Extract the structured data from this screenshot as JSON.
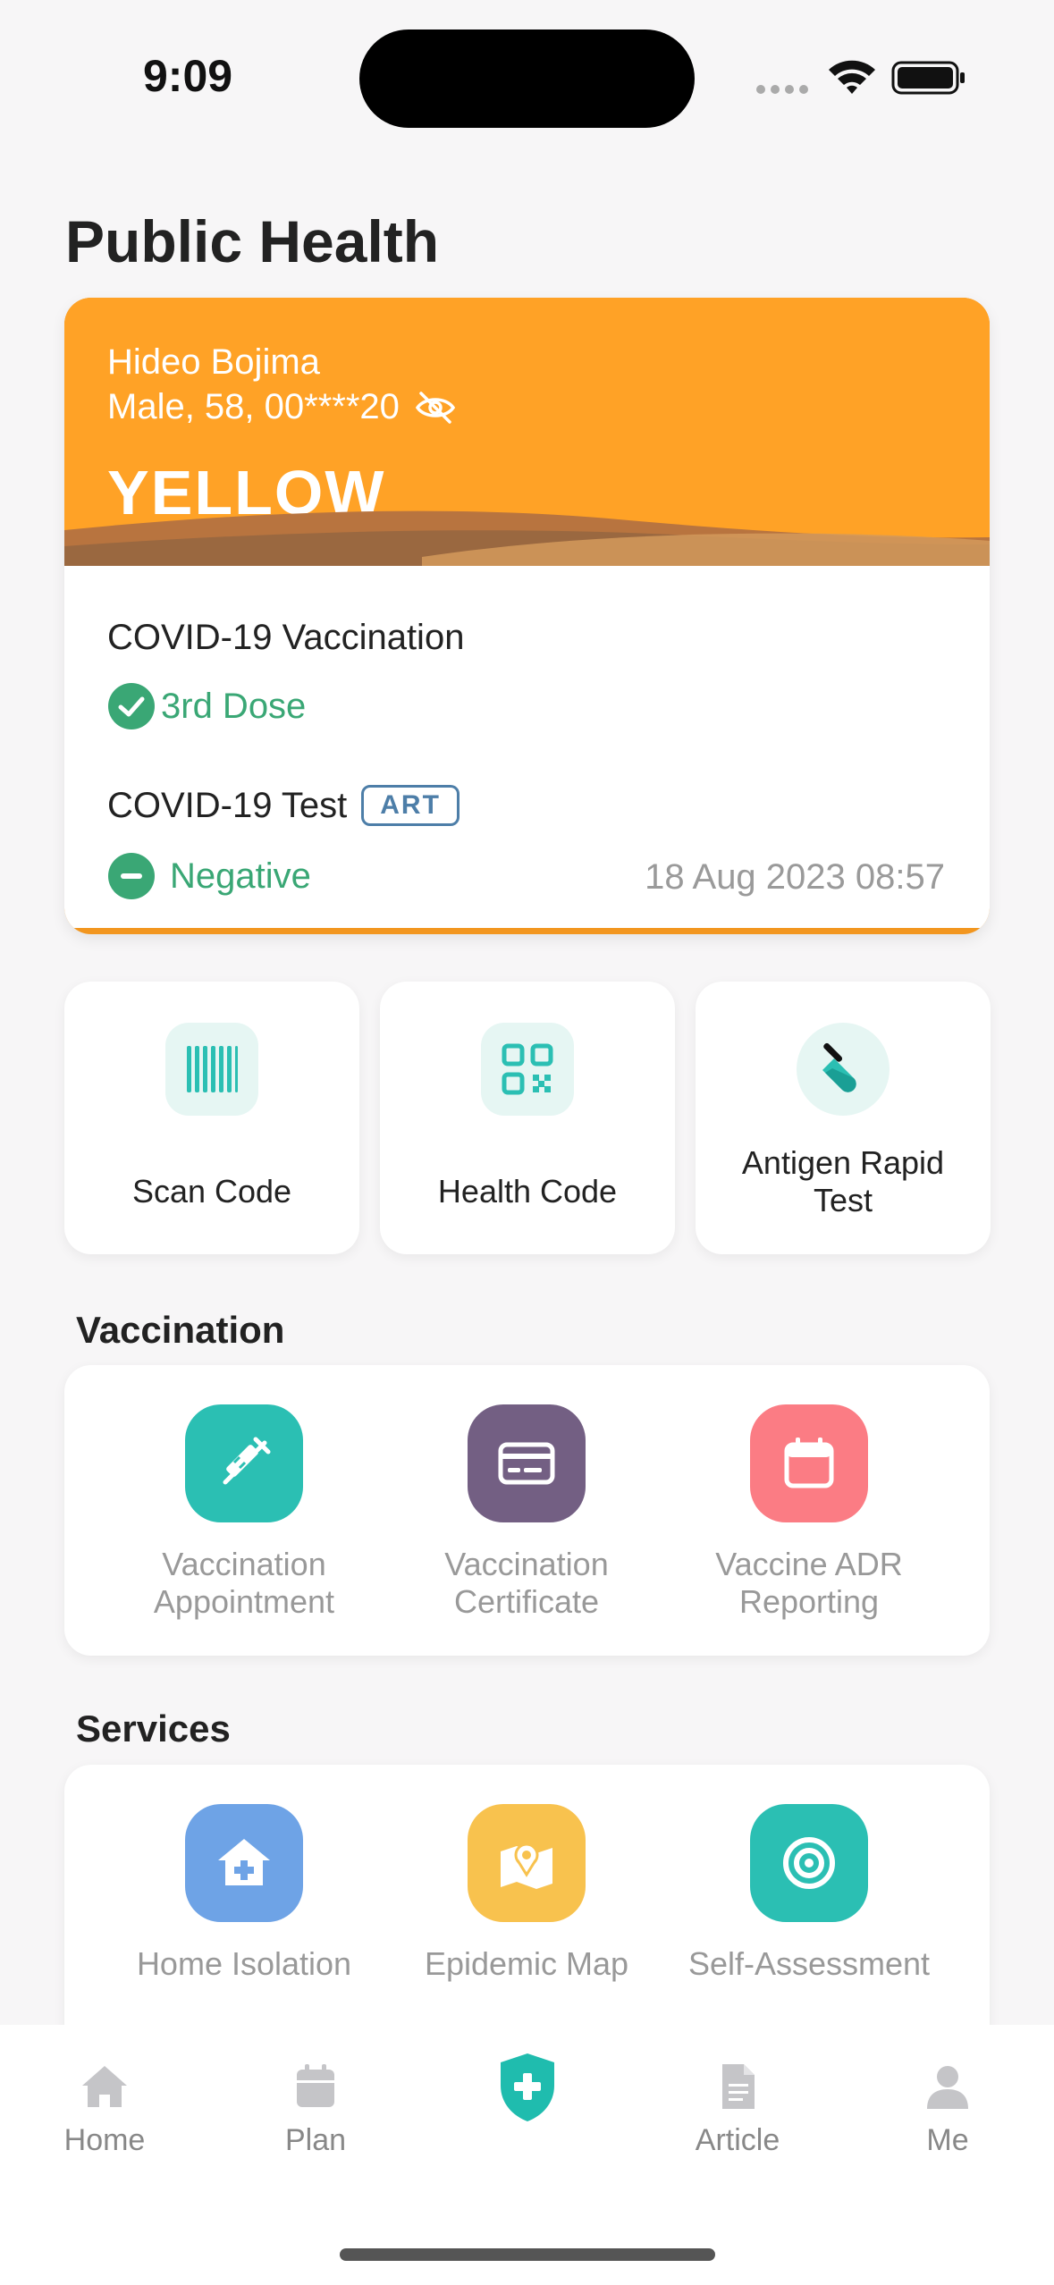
{
  "status_bar": {
    "time": "9:09"
  },
  "page_title": "Public Health",
  "profile": {
    "name": "Hideo Bojima",
    "info": "Male, 58, 00****20",
    "status": "YELLOW",
    "vaccination_title": "COVID-19 Vaccination",
    "dose": "3rd Dose",
    "test_title": "COVID-19 Test",
    "test_badge": "ART",
    "test_result": "Negative",
    "test_date": "18 Aug 2023 08:57"
  },
  "quick_actions": [
    {
      "label": "Scan Code",
      "icon": "barcode-icon"
    },
    {
      "label": "Health Code",
      "icon": "qr-code-icon"
    },
    {
      "label_line1": "Antigen Rapid",
      "label_line2": "Test",
      "icon": "test-tube-icon"
    }
  ],
  "vaccination": {
    "title": "Vaccination",
    "items": [
      {
        "line1": "Vaccination",
        "line2": "Appointment",
        "icon": "syringe-icon",
        "color": "#2bbfb3"
      },
      {
        "line1": "Vaccination",
        "line2": "Certificate",
        "icon": "card-icon",
        "color": "#735f83"
      },
      {
        "line1": "Vaccine ADR",
        "line2": "Reporting",
        "icon": "calendar-icon",
        "color": "#fb7c84"
      }
    ]
  },
  "services": {
    "title": "Services",
    "items": [
      {
        "label": "Home Isolation",
        "icon": "home-medical-icon",
        "color": "#6ea3e6"
      },
      {
        "label": "Epidemic Map",
        "icon": "map-icon",
        "color": "#f8c24e"
      },
      {
        "label": "Self-Assessment",
        "icon": "target-icon",
        "color": "#2bbfb3"
      }
    ]
  },
  "bottom_nav": [
    {
      "label": "Home",
      "icon": "home-icon"
    },
    {
      "label": "Plan",
      "icon": "calendar-icon"
    },
    {
      "label": "",
      "icon": "shield-medical-icon"
    },
    {
      "label": "Article",
      "icon": "document-icon"
    },
    {
      "label": "Me",
      "icon": "person-icon"
    }
  ],
  "colors": {
    "accent": "#2bbfb3",
    "status_yellow": "#ffa226",
    "success": "#3aa775"
  }
}
